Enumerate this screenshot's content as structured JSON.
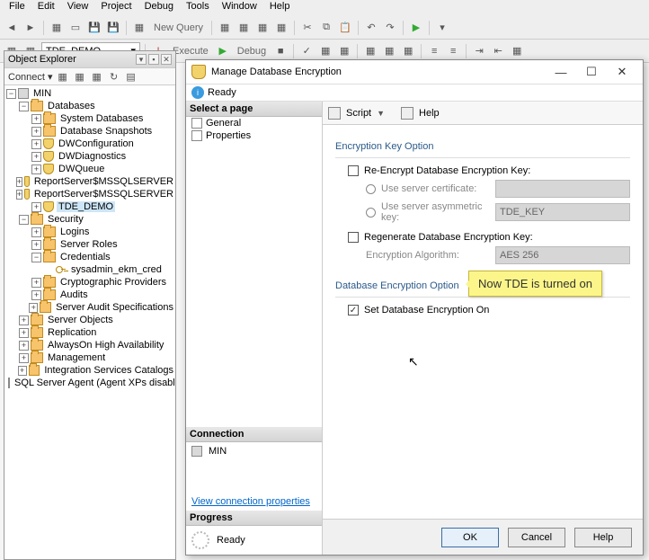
{
  "menu": {
    "items": [
      "File",
      "Edit",
      "View",
      "Project",
      "Debug",
      "Tools",
      "Window",
      "Help"
    ]
  },
  "toolbar1": {
    "new_query": "New Query"
  },
  "toolbar2": {
    "db_combo": "TDE_DEMO",
    "execute": "Execute",
    "debug": "Debug"
  },
  "object_explorer": {
    "title": "Object Explorer",
    "connect_label": "Connect ▾",
    "root": "MIN",
    "databases": "Databases",
    "db_children": [
      "System Databases",
      "Database Snapshots",
      "DWConfiguration",
      "DWDiagnostics",
      "DWQueue",
      "ReportServer$MSSQLSERVER",
      "ReportServer$MSSQLSERVER",
      "TDE_DEMO"
    ],
    "security": "Security",
    "security_children": [
      "Logins",
      "Server Roles",
      "Credentials"
    ],
    "cred_item": "sysadmin_ekm_cred",
    "security_tail": [
      "Cryptographic Providers",
      "Audits",
      "Server Audit Specifications"
    ],
    "root_tail": [
      "Server Objects",
      "Replication",
      "AlwaysOn High Availability",
      "Management",
      "Integration Services Catalogs",
      "SQL Server Agent (Agent XPs disabl"
    ]
  },
  "dialog": {
    "title": "Manage Database Encryption",
    "status": "Ready",
    "select_page": "Select a page",
    "pages": [
      "General",
      "Properties"
    ],
    "connection_hdr": "Connection",
    "connection_server": "MIN",
    "view_conn": "View connection properties",
    "progress_hdr": "Progress",
    "progress_state": "Ready",
    "toolbar": {
      "script": "Script",
      "help": "Help"
    },
    "grp1": "Encryption Key Option",
    "reencrypt": "Re-Encrypt Database Encryption Key:",
    "use_cert": "Use server certificate:",
    "use_asym": "Use server asymmetric key:",
    "asym_val": "TDE_KEY",
    "regen": "Regenerate Database Encryption Key:",
    "enc_alg": "Encryption Algorithm:",
    "enc_alg_val": "AES 256",
    "grp2": "Database Encryption Option",
    "set_on": "Set Database Encryption On",
    "callout": "Now TDE is turned on",
    "ok": "OK",
    "cancel": "Cancel",
    "helpbtn": "Help"
  }
}
